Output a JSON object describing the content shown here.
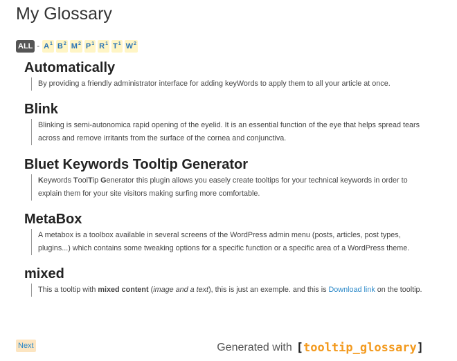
{
  "page": {
    "title": "My Glossary"
  },
  "letters": {
    "all": "ALL",
    "separator": "-",
    "items": [
      {
        "letter": "A",
        "count": "1"
      },
      {
        "letter": "B",
        "count": "2"
      },
      {
        "letter": "M",
        "count": "2"
      },
      {
        "letter": "P",
        "count": "1"
      },
      {
        "letter": "R",
        "count": "1"
      },
      {
        "letter": "T",
        "count": "1"
      },
      {
        "letter": "W",
        "count": "2"
      }
    ]
  },
  "entries": [
    {
      "term": "Automatically",
      "description": "By providing a friendly administrator interface for adding keyWords to apply them to all your article at once."
    },
    {
      "term": "Blink",
      "description": "Blinking is semi-autonomica rapid opening of the eyelid. It is an essential function of the eye that helps spread tears across and remove irritants from the surface of the cornea and conjunctiva."
    },
    {
      "term": "Bluet Keywords Tooltip Generator",
      "description_parts": {
        "k_bold": "K",
        "k_rest": "eywords ",
        "t_bold": "T",
        "t_mid": "ool",
        "t_bold2": "T",
        "t_rest": "ip ",
        "g_bold": "G",
        "rest": "enerator this plugin allows you easely create tooltips for your technical keywords in order to explain them for your site visitors making surfing more comfortable."
      }
    },
    {
      "term": "MetaBox",
      "description": "A metabox is a toolbox available in several screens of the WordPress admin menu (posts, articles, post types, plugins...) which contains some tweaking options for a specific function or a specific area of a WordPress theme."
    },
    {
      "term": "mixed",
      "description_parts": {
        "pre": "This a tooltip with ",
        "bold": "mixed content",
        "mid1": " (",
        "italic": "image and a text",
        "mid2": "), this is just an exemple. and this is ",
        "link": "Download link",
        "post": " on the tooltip."
      }
    }
  ],
  "footer": {
    "next": "Next",
    "generated_with": "Generated with",
    "brand_open": "[",
    "brand": "tooltip_glossary",
    "brand_close": "]"
  }
}
